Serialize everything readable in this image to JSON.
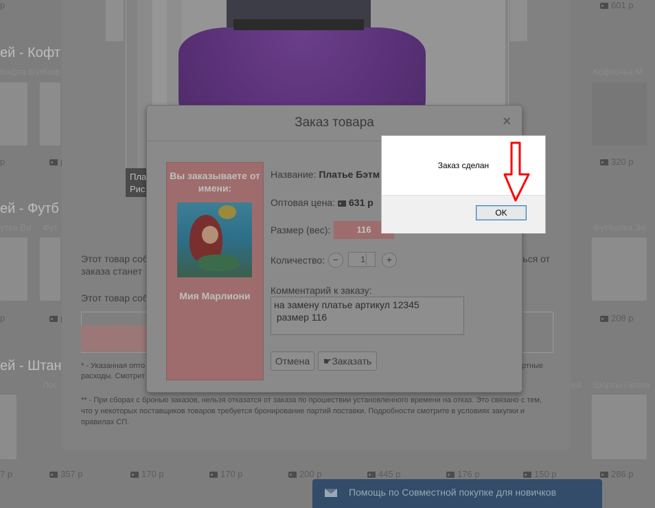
{
  "background": {
    "sections": [
      "ей - Кофт",
      "ей - Футб",
      "ей  - Штан"
    ],
    "row1": {
      "names": [
        "Кофта Бэт",
        "Коф",
        "Кофточка М"
      ],
      "prices": [
        "р",
        "р",
        "320 р"
      ]
    },
    "row2": {
      "names": [
        "утка Ви",
        "Фут",
        "Футболка Зо"
      ],
      "prices": [
        "р",
        "р",
        "208 р"
      ]
    },
    "row3": {
      "names": [
        "Лос",
        "ей",
        "Шорты Пеппа"
      ],
      "prices": [
        "7 р",
        "357 р",
        "170 р",
        "170 р",
        "200 р",
        "445 р",
        "176 р",
        "150 р",
        "286 р"
      ]
    },
    "top_prices": [
      "р",
      "601 р"
    ]
  },
  "product": {
    "caption_line1": "Пла",
    "caption_line2": "Рис",
    "text_line1": "Этот товар собе",
    "text_line1_right": "ться от",
    "text_line2": "заказа станет",
    "text_line3": "Этот товар собе",
    "footnote1_line1": "* - Указанная опто",
    "footnote1_right": "ртные",
    "footnote1_line2": "расходы. Смотрит",
    "footnote2": "** - При сборах с бронью заказов, нельзя отказатся от заказа по прошествии установленного времени на отказ. Это связано с тем, что у некоторых поставщиков товаров требуется бронирование партий поставки. Подробности смотрите в условиях закупки и правилах СП."
  },
  "order_dialog": {
    "title": "Заказ товара",
    "close_glyph": "×",
    "buyer_heading": "Вы заказываете от имени:",
    "buyer_name": "Мия Марлиони",
    "name_label": "Название:",
    "name_value": "Платье Бэтм",
    "price_label": "Оптовая цена:",
    "price_value": "631 р",
    "size_label": "Размер (вес):",
    "size_value": "116",
    "qty_label": "Количество:",
    "qty_minus": "−",
    "qty_value": "1",
    "qty_plus": "+",
    "comment_label": "Комментарий к заказу:",
    "comment_value": "на замену платье артикул 12345\n размер 116",
    "cancel_label": "Отмена",
    "order_label": "Заказать"
  },
  "alert": {
    "message": "Заказ сделан",
    "ok_label": "OK"
  },
  "help_bar": {
    "label": "Помощь по Совместной покупке для новичков"
  },
  "colors": {
    "overlay": "#7d7d7d",
    "buyer_panel": "#9e6c6c",
    "help_bar": "#324c69",
    "alert_arrow": "#ff0000",
    "ok_border": "#3c7fb1"
  }
}
